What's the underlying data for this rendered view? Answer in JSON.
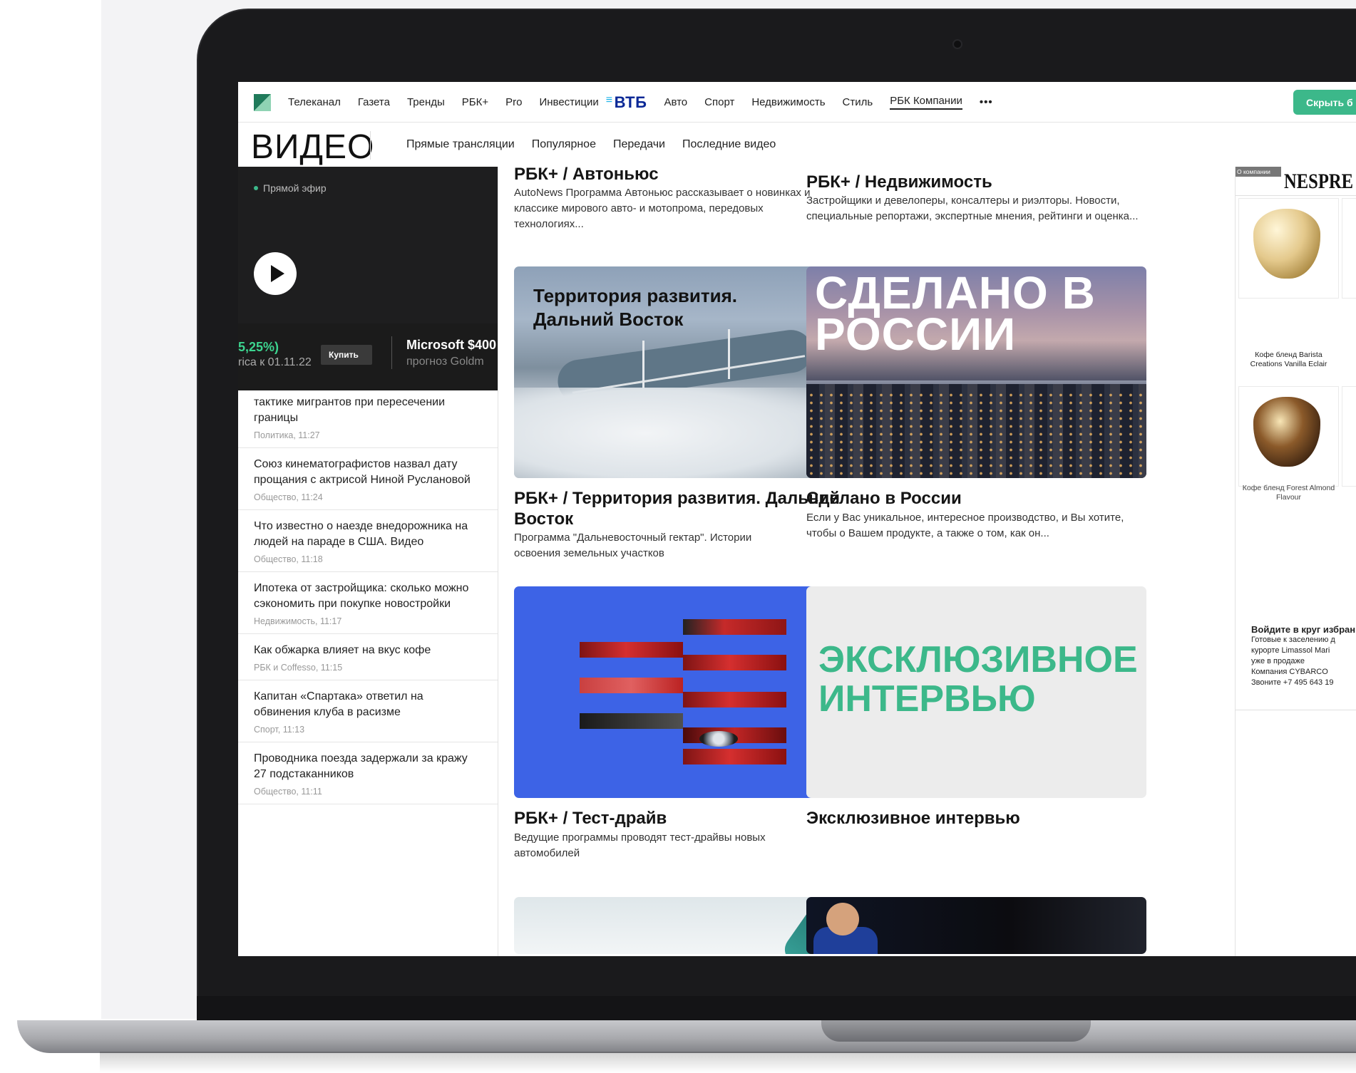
{
  "topnav": {
    "items": [
      "Телеканал",
      "Газета",
      "Тренды",
      "РБК+",
      "Pro",
      "Инвестиции"
    ],
    "sponsor": "ВТБ",
    "items2": [
      "Авто",
      "Спорт",
      "Недвижимость",
      "Стиль",
      "РБК Компании"
    ],
    "more": "•••",
    "hide_button": "Скрыть б"
  },
  "section": {
    "title": "ВИДЕО",
    "links": [
      "Прямые трансляции",
      "Популярное",
      "Передачи",
      "Последние видео"
    ]
  },
  "player": {
    "live_label": "Прямой эфир",
    "ticker_pct": "5,25%)",
    "ticker_date": "rica к 01.11.22",
    "buy_label": "Купить",
    "ms_title": "Microsoft $400",
    "ms_sub": "прогноз Goldm"
  },
  "news": [
    {
      "title": "тактике мигрантов при пересечении границы",
      "meta": "Политика, 11:27"
    },
    {
      "title": "Союз кинематографистов назвал дату прощания с актрисой Ниной Руслановой",
      "meta": "Общество, 11:24"
    },
    {
      "title": "Что известно о наезде внедорожника на людей на параде в США. Видео",
      "meta": "Общество, 11:18"
    },
    {
      "title": "Ипотека от застройщика: сколько можно сэкономить при покупке новостройки",
      "meta": "Недвижимость, 11:17"
    },
    {
      "title": "Как обжарка влияет на вкус кофе",
      "meta": "РБК и Coffesso, 11:15"
    },
    {
      "title": "Капитан «Спартака» ответил на обвинения клуба в расизме",
      "meta": "Спорт, 11:13"
    },
    {
      "title": "Проводника поезда задержали за кражу 27 подстаканников",
      "meta": "Общество, 11:11"
    }
  ],
  "cards": [
    {
      "title": "РБК+ / Автоньюс",
      "desc": "AutoNews Программа Автоньюс рассказывает о новинках и классике мирового авто- и мотопрома, передовых технологиях..."
    },
    {
      "title": "РБК+ / Недвижимость",
      "desc": "Застройщики и девелоперы, консалтеры и риэлторы. Новости, специальные репортажи, экспертные мнения, рейтинги и оценка..."
    },
    {
      "title": "РБК+ / Территория развития. Дальний Восток",
      "desc": "Программа \"Дальневосточный гектар\". Истории освоения земельных участков",
      "thumb_text": "Территория развития. Дальний Восток"
    },
    {
      "title": "Сделано в России",
      "desc": "Если у Вас уникальное, интересное производство, и Вы хотите, чтобы о Вашем продукте, а также о том, как он...",
      "thumb_text": "СДЕЛАНО В РОССИИ"
    },
    {
      "title": "РБК+ / Тест-драйв",
      "desc": "Ведущие программы проводят тест-драйвы новых автомобилей"
    },
    {
      "title": "Эксклюзивное интервью",
      "desc": "",
      "thumb_text": "ЭКСКЛЮЗИВНОЕ ИНТЕРВЬЮ"
    }
  ],
  "ad": {
    "label": "О компании",
    "brand": "NESPRE",
    "products": [
      {
        "name": "Кофе бленд Barista Creations Vanilla Eclair"
      },
      {
        "name": "Кофе бленд Forest Almond Flavour"
      }
    ],
    "text_lines": [
      "Войдите в круг избран",
      "Готовые к заселению д",
      "курорте Limassol Mari",
      "уже в продаже",
      "Компания CYBARCO",
      "Звоните +7 495 643 19"
    ]
  },
  "colors": {
    "accent": "#3cb88a",
    "vtb": "#0a2896",
    "blue_thumb": "#3d63e6"
  }
}
